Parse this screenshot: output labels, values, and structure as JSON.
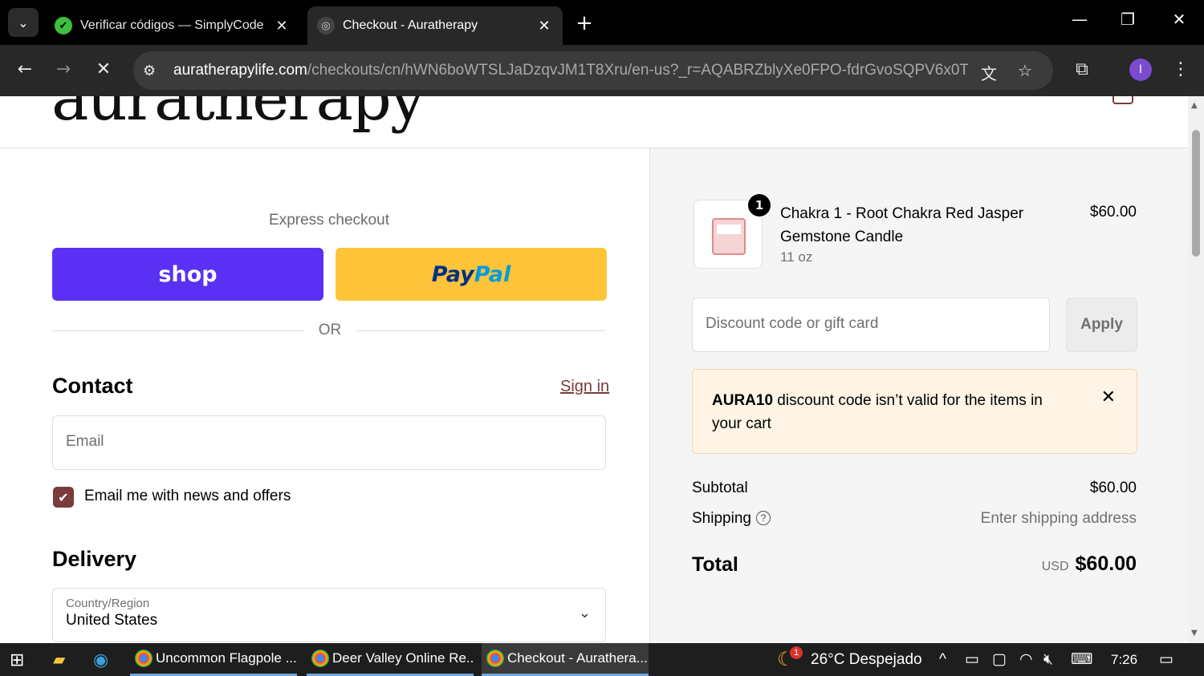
{
  "browser": {
    "tabs": [
      {
        "title": "Verificar códigos — SimplyCode",
        "active": false
      },
      {
        "title": "Checkout - Auratherapy",
        "active": true
      }
    ],
    "url_host": "auratherapylife.com",
    "url_path": "/checkouts/cn/hWN6boWTSLJaDzqvJM1T8Xru/en-us?_r=AQABRZblyXe0FPO-fdrGvoSQPV6x0T...",
    "profile_initial": "I"
  },
  "store": {
    "logo_text": "auratherapy"
  },
  "checkout": {
    "express_label": "Express checkout",
    "shop_label": "shop",
    "paypal_pay": "Pay",
    "paypal_pal": "Pal",
    "or_label": "OR",
    "contact_heading": "Contact",
    "signin_label": "Sign in",
    "email_placeholder": "Email",
    "news_label": "Email me with news and offers",
    "news_checked": true,
    "delivery_heading": "Delivery",
    "country_label": "Country/Region",
    "country_value": "United States"
  },
  "summary": {
    "item": {
      "quantity": "1",
      "name": "Chakra 1 - Root Chakra Red Jasper Gemstone Candle",
      "variant": "11 oz",
      "price": "$60.00"
    },
    "discount_placeholder": "Discount code or gift card",
    "apply_label": "Apply",
    "alert_code": "AURA10",
    "alert_message": " discount code isn’t valid for the items in your cart",
    "subtotal_label": "Subtotal",
    "subtotal_value": "$60.00",
    "shipping_label": "Shipping",
    "shipping_value": "Enter shipping address",
    "total_label": "Total",
    "total_currency": "USD",
    "total_value": "$60.00"
  },
  "taskbar": {
    "apps": [
      {
        "title": "Uncommon Flagpole ..."
      },
      {
        "title": "Deer Valley Online Re..."
      },
      {
        "title": "Checkout - Auratherа..."
      }
    ],
    "weather": "26°C  Despejado",
    "weather_badge": "1",
    "time": "7:26"
  }
}
